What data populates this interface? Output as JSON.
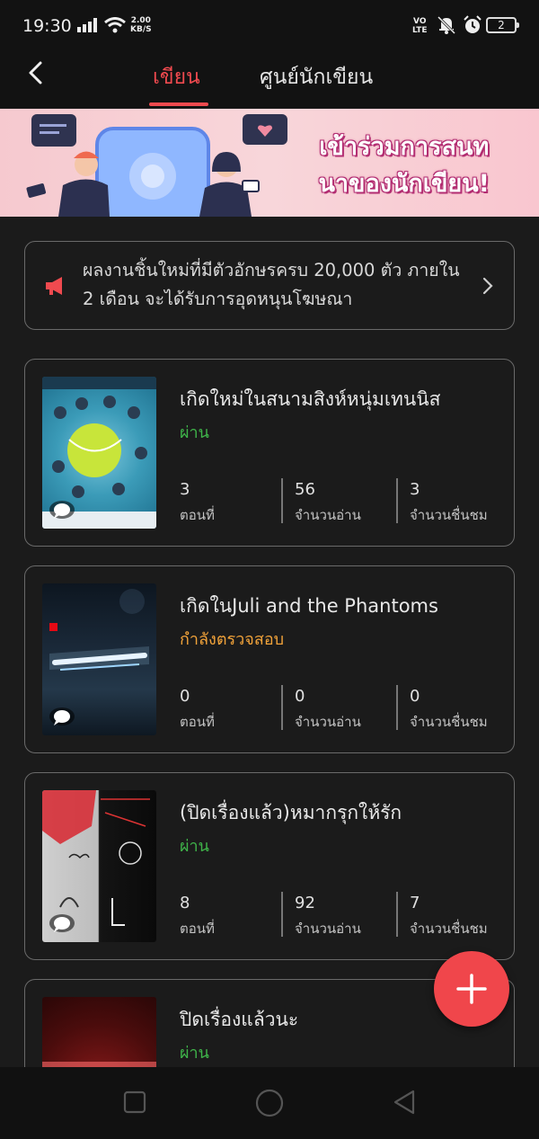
{
  "status_bar": {
    "time": "19:30",
    "speed_value": "2.00",
    "speed_unit": "KB/S",
    "volte_top": "VO",
    "volte_bottom": "LTE",
    "battery": "2",
    "icons": [
      "signal-icon",
      "wifi-icon",
      "bell-off-icon",
      "alarm-icon",
      "battery-icon"
    ]
  },
  "header": {
    "back_icon": "back-chevron-icon",
    "tabs": [
      {
        "label": "เขียน",
        "active": true
      },
      {
        "label": "ศูนย์นักเขียน",
        "active": false
      }
    ],
    "accent_color": "#f04a4f"
  },
  "banner": {
    "line1": "เข้าร่วมการสนท",
    "line2": "นาของนักเขียน!"
  },
  "notice": {
    "icon": "megaphone-icon",
    "text": "ผลงานชิ้นใหม่ที่มีตัวอักษรครบ 20,000 ตัว ภายใน 2 เดือน จะได้รับการอุดหนุนโฆษณา",
    "chevron": "chevron-right-icon"
  },
  "stories": [
    {
      "title": "เกิดใหม่ในสนามสิงห์หนุ่มเทนนิส",
      "status": "ผ่าน",
      "status_type": "pass",
      "stats": [
        {
          "value": "3",
          "label": "ตอนที่"
        },
        {
          "value": "56",
          "label": "จำนวนอ่าน"
        },
        {
          "value": "3",
          "label": "จำนวนชื่นชม"
        }
      ]
    },
    {
      "title": "เกิดในJuli and the Phantoms",
      "status": "กำลังตรวจสอบ",
      "status_type": "review",
      "stats": [
        {
          "value": "0",
          "label": "ตอนที่"
        },
        {
          "value": "0",
          "label": "จำนวนอ่าน"
        },
        {
          "value": "0",
          "label": "จำนวนชื่นชม"
        }
      ]
    },
    {
      "title": "(ปิดเรื่องแล้ว)หมากรุกให้รัก",
      "status": "ผ่าน",
      "status_type": "pass",
      "stats": [
        {
          "value": "8",
          "label": "ตอนที่"
        },
        {
          "value": "92",
          "label": "จำนวนอ่าน"
        },
        {
          "value": "7",
          "label": "จำนวนชื่นชม"
        }
      ]
    },
    {
      "title": "ปิดเรื่องแล้วนะ",
      "status": "ผ่าน",
      "status_type": "pass"
    }
  ],
  "fab": {
    "icon": "plus-icon"
  },
  "nav_bar": {
    "icons": [
      "recents-square-icon",
      "home-circle-icon",
      "back-triangle-icon"
    ]
  },
  "colors": {
    "background": "#1b1b1b",
    "pass": "#3fb54a",
    "review": "#f2a33a",
    "accent": "#f04a4f"
  }
}
